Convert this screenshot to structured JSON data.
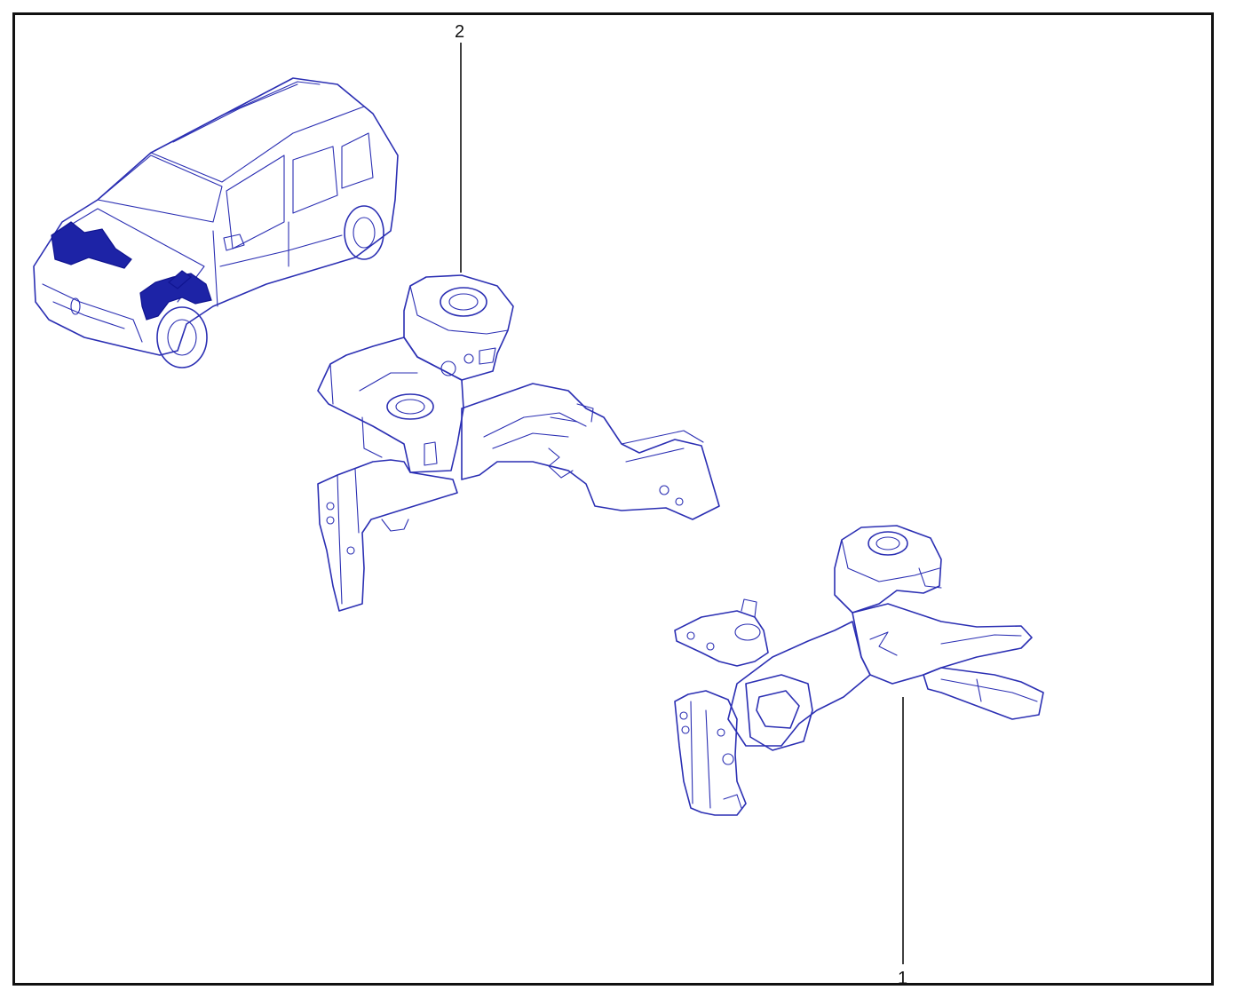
{
  "diagram": {
    "type": "exploded-parts-diagram",
    "line_color": "#2b2fb3",
    "frame_color": "#111111",
    "callouts": [
      {
        "id": "callout-1",
        "label": "1"
      },
      {
        "id": "callout-2",
        "label": "2"
      }
    ]
  }
}
